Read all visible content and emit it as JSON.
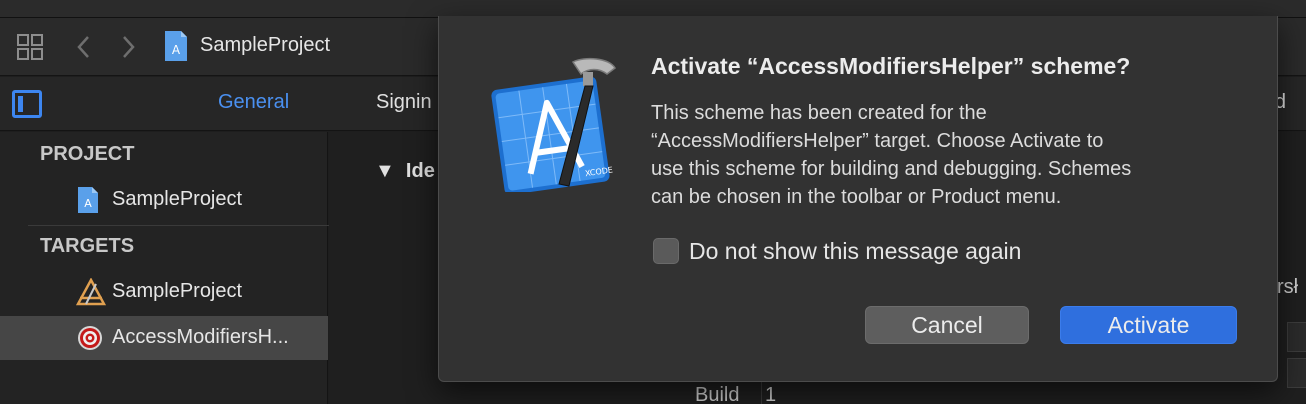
{
  "toolbar": {
    "project_title": "SampleProject",
    "icons": [
      "grid-icon",
      "back-arrow-icon",
      "forward-arrow-icon",
      "project-file-icon"
    ]
  },
  "tabs": {
    "general": "General",
    "signing": "Signin",
    "build_clipped": "ild"
  },
  "sidebar": {
    "project_header": "PROJECT",
    "project_item": "SampleProject",
    "targets_header": "TARGETS",
    "targets": [
      {
        "label": "SampleProject",
        "icon": "app-target-icon"
      },
      {
        "label": "AccessModifiersH...",
        "icon": "target-bullseye-icon",
        "selected": true
      }
    ]
  },
  "content": {
    "identity_header": "Ide",
    "right_clipped": "rsł",
    "build_label": "Build",
    "build_value": "1"
  },
  "dialog": {
    "title": "Activate “AccessModifiersHelper” scheme?",
    "message_lines": [
      "This scheme has been created for the",
      "“AccessModifiersHelper” target. Choose Activate to",
      "use this scheme for building and debugging. Schemes",
      "can be chosen in the toolbar or Product menu."
    ],
    "checkbox_label": "Do not show this message again",
    "checkbox_checked": false,
    "cancel_label": "Cancel",
    "activate_label": "Activate",
    "icon": "xcode-app-icon"
  },
  "colors": {
    "accent": "#2f6fde",
    "tab_active": "#4a90f0"
  }
}
